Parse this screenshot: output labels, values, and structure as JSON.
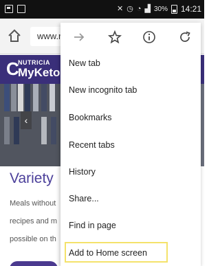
{
  "status_bar": {
    "battery_text": "30%",
    "time": "14:21"
  },
  "address_bar": {
    "url": "www.r"
  },
  "page": {
    "logo_letter": "C",
    "logo_small": "NUTRICIA",
    "logo_big": "MyKeto",
    "heading": "Variety",
    "lines": [
      "Meals without",
      "recipes and m",
      "possible on th"
    ],
    "colors": {
      "header": "#3a2f7a",
      "heading": "#4b3f9a",
      "cta": "#4b3a8f"
    }
  },
  "menu": {
    "toolbar_icons": [
      "forward-arrow-icon",
      "star-icon",
      "info-icon",
      "refresh-icon"
    ],
    "items": [
      "New tab",
      "New incognito tab",
      "Bookmarks",
      "Recent tabs",
      "History",
      "Share...",
      "Find in page",
      "Add to Home screen"
    ],
    "highlight_color": "#f4e26a"
  }
}
